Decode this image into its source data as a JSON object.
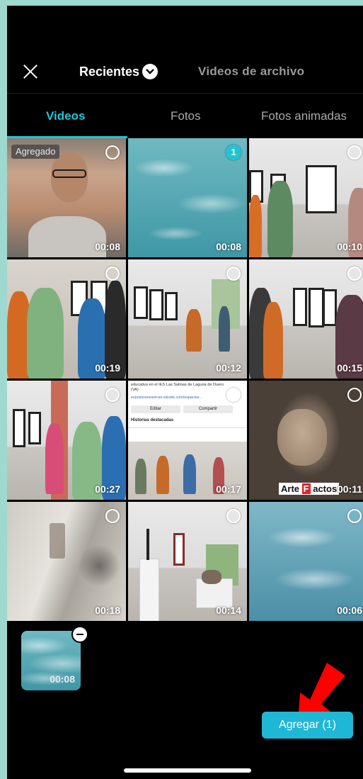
{
  "header": {
    "album": "Recientes",
    "archive_tab": "Videos de archivo"
  },
  "tabs": [
    {
      "label": "Videos",
      "active": true
    },
    {
      "label": "Fotos",
      "active": false
    },
    {
      "label": "Fotos animadas",
      "active": false
    }
  ],
  "grid": [
    {
      "duration": "00:08",
      "badge": "Agregado",
      "selected_index": ""
    },
    {
      "duration": "00:08",
      "badge": "",
      "selected_index": "1"
    },
    {
      "duration": "00:10",
      "badge": "",
      "selected_index": ""
    },
    {
      "duration": "00:19",
      "badge": "",
      "selected_index": ""
    },
    {
      "duration": "00:12",
      "badge": "",
      "selected_index": ""
    },
    {
      "duration": "00:15",
      "badge": "",
      "selected_index": ""
    },
    {
      "duration": "00:27",
      "badge": "",
      "selected_index": ""
    },
    {
      "duration": "00:17",
      "badge": "",
      "selected_index": ""
    },
    {
      "duration": "00:11",
      "badge": "",
      "selected_index": ""
    },
    {
      "duration": "00:18",
      "badge": "",
      "selected_index": ""
    },
    {
      "duration": "00:14",
      "badge": "",
      "selected_index": ""
    },
    {
      "duration": "00:06",
      "badge": "",
      "selected_index": ""
    }
  ],
  "tile7": {
    "line1": "educativa en el IES Las Salinas de Laguna de Duero",
    "line2": "(VA)",
    "url": "exposicionesnirver.wixsite.com/espacios...",
    "btn_edit": "Editar",
    "btn_share": "Compartir",
    "highlights": "Historias destacadas"
  },
  "tile9_overlay": {
    "a": "Arte",
    "b": "F",
    "c": "actos"
  },
  "tray": {
    "duration": "00:08"
  },
  "add_button": "Agregar (1)",
  "colors": {
    "accent": "#22c3d6",
    "arrow": "#ff0000"
  }
}
